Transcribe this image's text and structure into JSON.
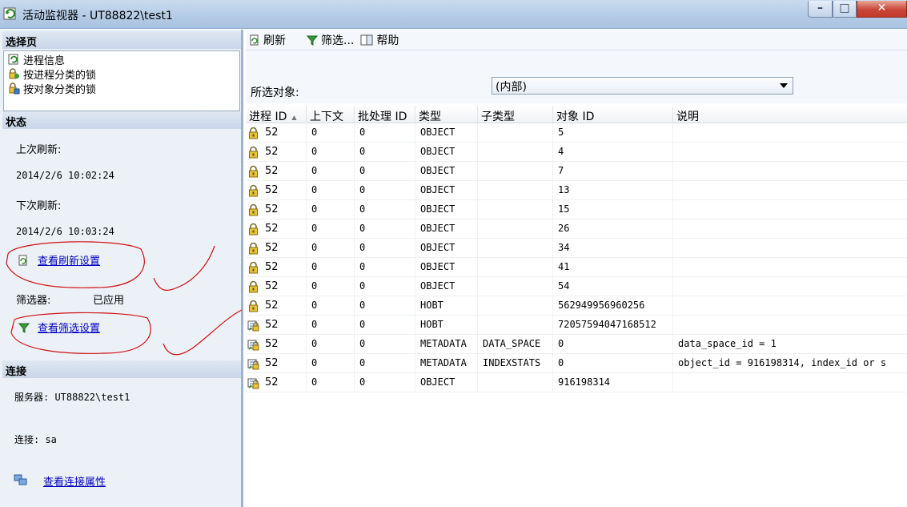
{
  "window": {
    "title": "活动监视器 - UT88822\\test1",
    "min_glyph": "–",
    "max_glyph": "□",
    "close_glyph": "✕"
  },
  "left": {
    "pages_header": "选择页",
    "pages": [
      {
        "label": "进程信息",
        "icon": "process-info-icon"
      },
      {
        "label": "按进程分类的锁",
        "icon": "lock-by-process-icon"
      },
      {
        "label": "按对象分类的锁",
        "icon": "lock-by-object-icon"
      }
    ],
    "status_header": "状态",
    "last_refresh_label": "上次刷新:",
    "last_refresh_value": "2014/2/6 10:02:24",
    "next_refresh_label": "下次刷新:",
    "next_refresh_value": "2014/2/6 10:03:24",
    "refresh_settings_link": "查看刷新设置",
    "filter_label": "筛选器:",
    "filter_value": "已应用",
    "filter_settings_link": "查看筛选设置",
    "connection_header": "连接",
    "server_text": "服务器: UT88822\\test1",
    "connection_text": "连接: sa",
    "connection_props_link": "查看连接属性"
  },
  "toolbar": {
    "refresh_label": "刷新",
    "filter_label": "筛选...",
    "help_label": "帮助"
  },
  "object_selector": {
    "label": "所选对象:",
    "value": "(内部)"
  },
  "grid": {
    "columns": [
      "进程 ID",
      "上下文",
      "批处理 ID",
      "类型",
      "子类型",
      "对象 ID",
      "说明"
    ],
    "rows": [
      {
        "icon": "lock",
        "spid": "52",
        "ctx": "0",
        "batch": "0",
        "type": "OBJECT",
        "subtype": "",
        "objid": "5",
        "desc": ""
      },
      {
        "icon": "lock",
        "spid": "52",
        "ctx": "0",
        "batch": "0",
        "type": "OBJECT",
        "subtype": "",
        "objid": "4",
        "desc": ""
      },
      {
        "icon": "lock",
        "spid": "52",
        "ctx": "0",
        "batch": "0",
        "type": "OBJECT",
        "subtype": "",
        "objid": "7",
        "desc": ""
      },
      {
        "icon": "lock",
        "spid": "52",
        "ctx": "0",
        "batch": "0",
        "type": "OBJECT",
        "subtype": "",
        "objid": "13",
        "desc": ""
      },
      {
        "icon": "lock",
        "spid": "52",
        "ctx": "0",
        "batch": "0",
        "type": "OBJECT",
        "subtype": "",
        "objid": "15",
        "desc": ""
      },
      {
        "icon": "lock",
        "spid": "52",
        "ctx": "0",
        "batch": "0",
        "type": "OBJECT",
        "subtype": "",
        "objid": "26",
        "desc": ""
      },
      {
        "icon": "lock",
        "spid": "52",
        "ctx": "0",
        "batch": "0",
        "type": "OBJECT",
        "subtype": "",
        "objid": "34",
        "desc": ""
      },
      {
        "icon": "lock",
        "spid": "52",
        "ctx": "0",
        "batch": "0",
        "type": "OBJECT",
        "subtype": "",
        "objid": "41",
        "desc": ""
      },
      {
        "icon": "lock",
        "spid": "52",
        "ctx": "0",
        "batch": "0",
        "type": "OBJECT",
        "subtype": "",
        "objid": "54",
        "desc": ""
      },
      {
        "icon": "lock",
        "spid": "52",
        "ctx": "0",
        "batch": "0",
        "type": "HOBT",
        "subtype": "",
        "objid": "562949956960256",
        "desc": ""
      },
      {
        "icon": "grant",
        "spid": "52",
        "ctx": "0",
        "batch": "0",
        "type": "HOBT",
        "subtype": "",
        "objid": "72057594047168512",
        "desc": ""
      },
      {
        "icon": "grant",
        "spid": "52",
        "ctx": "0",
        "batch": "0",
        "type": "METADATA",
        "subtype": "DATA_SPACE",
        "objid": "0",
        "desc": "data_space_id = 1"
      },
      {
        "icon": "grant",
        "spid": "52",
        "ctx": "0",
        "batch": "0",
        "type": "METADATA",
        "subtype": "INDEXSTATS",
        "objid": "0",
        "desc": "object_id = 916198314, index_id or s"
      },
      {
        "icon": "grant",
        "spid": "52",
        "ctx": "0",
        "batch": "0",
        "type": "OBJECT",
        "subtype": "",
        "objid": "916198314",
        "desc": ""
      }
    ]
  }
}
